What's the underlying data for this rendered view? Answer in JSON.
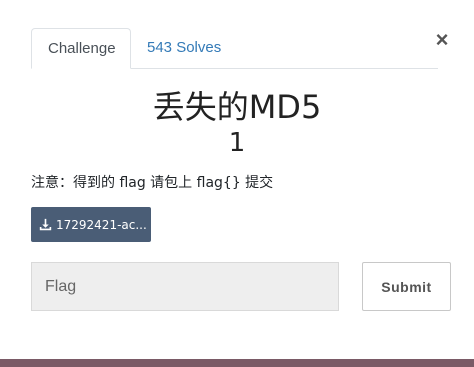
{
  "tabs": {
    "challenge": "Challenge",
    "solves": "543 Solves"
  },
  "close_icon": "×",
  "challenge": {
    "title": "丢失的MD5",
    "points": "1",
    "description": "注意：得到的 flag 请包上 flag{} 提交",
    "download_label": "17292421-ac..."
  },
  "form": {
    "flag_placeholder": "Flag",
    "submit_label": "Submit"
  },
  "colors": {
    "link": "#337ab7",
    "download_bg": "#4a5d76",
    "input_bg": "#eeeeee"
  }
}
